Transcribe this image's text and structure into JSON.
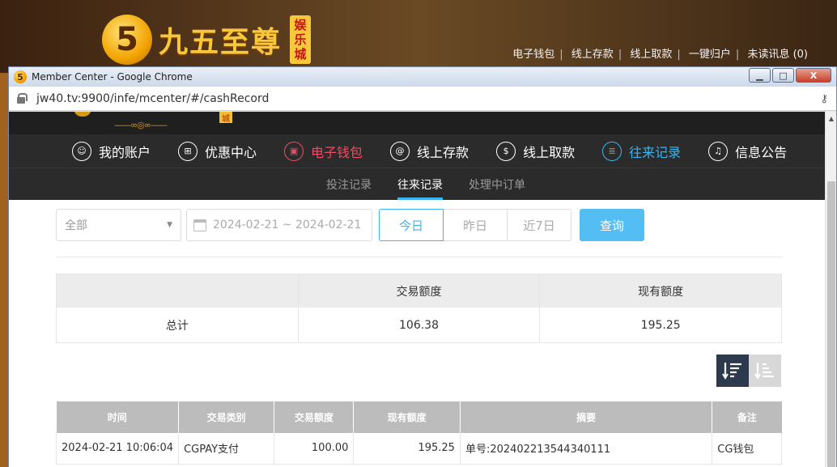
{
  "background_site": {
    "logo_glyph": "5",
    "logo_text": "九五至尊",
    "logo_tag": [
      "娱",
      "乐",
      "城"
    ],
    "links": [
      "电子钱包",
      "线上存款",
      "线上取款",
      "一键归户",
      "未读讯息 (0)"
    ]
  },
  "window": {
    "title": "Member Center - Google Chrome",
    "url": "jw40.tv:9900/infe/mcenter/#/cashRecord",
    "controls": {
      "minimize": "▁",
      "maximize": "□",
      "close": "X"
    }
  },
  "site": {
    "top_logo_tag": "城",
    "top_logo_deco": "——∞◎∞——"
  },
  "nav": {
    "items": [
      {
        "label": "我的账户",
        "icon": "user-icon",
        "glyph": "☺",
        "state": "normal"
      },
      {
        "label": "优惠中心",
        "icon": "gift-icon",
        "glyph": "⊞",
        "state": "normal"
      },
      {
        "label": "电子钱包",
        "icon": "wallet-icon",
        "glyph": "▣",
        "state": "red"
      },
      {
        "label": "线上存款",
        "icon": "deposit-icon",
        "glyph": "@",
        "state": "normal"
      },
      {
        "label": "线上取款",
        "icon": "withdraw-icon",
        "glyph": "$",
        "state": "normal"
      },
      {
        "label": "往来记录",
        "icon": "record-icon",
        "glyph": "≣",
        "state": "blue"
      },
      {
        "label": "信息公告",
        "icon": "bell-icon",
        "glyph": "♫",
        "state": "normal"
      }
    ]
  },
  "subnav": {
    "items": [
      {
        "label": "投注记录",
        "active": false
      },
      {
        "label": "往来记录",
        "active": true
      },
      {
        "label": "处理中订单",
        "active": false
      }
    ]
  },
  "filters": {
    "type_select": "全部",
    "date_range": "2024-02-21 ~ 2024-02-21",
    "quick": [
      "今日",
      "昨日",
      "近7日"
    ],
    "search_label": "查询"
  },
  "summary": {
    "headers": [
      "",
      "交易额度",
      "现有额度"
    ],
    "row": [
      "总计",
      "106.38",
      "195.25"
    ]
  },
  "records": {
    "headers": [
      "时间",
      "交易类别",
      "交易额度",
      "现有额度",
      "摘要",
      "备注"
    ],
    "rows": [
      [
        "2024-02-21 10:06:04",
        "CGPAY支付",
        "100.00",
        "195.25",
        "单号:202402213544340111",
        "CG钱包"
      ]
    ]
  },
  "colors": {
    "accent_blue": "#3db4f2",
    "accent_red": "#f04b64",
    "nav_bg": "#2b2b2b",
    "search_button": "#53bdf4"
  }
}
